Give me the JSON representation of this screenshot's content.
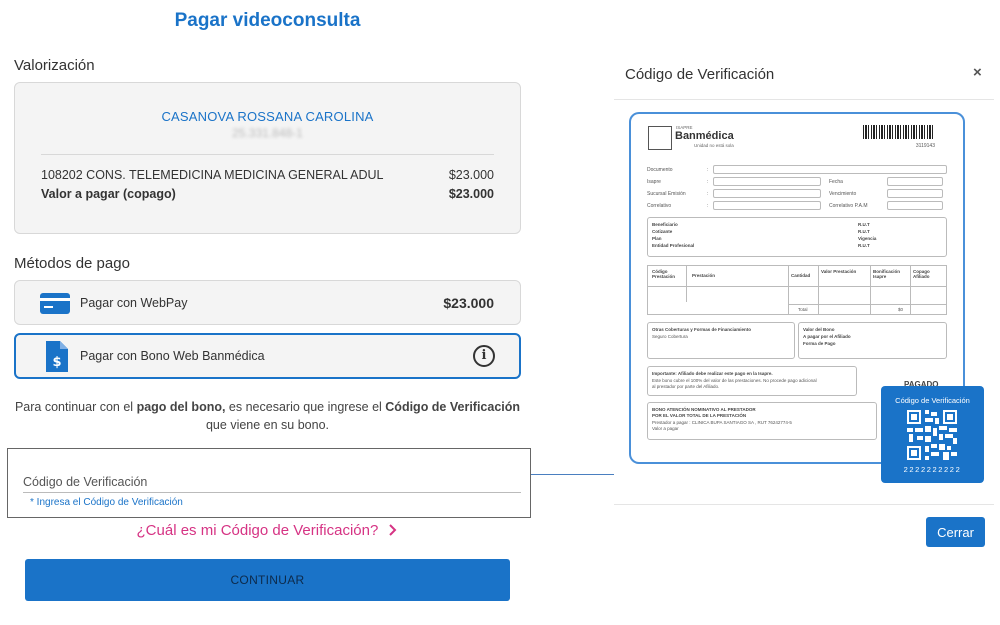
{
  "page": {
    "title": "Pagar videoconsulta"
  },
  "valorizacion": {
    "heading": "Valorización",
    "doctor_name": "CASANOVA ROSSANA CAROLINA",
    "doctor_rut": "25.331.848-1",
    "items": [
      {
        "label": "108202 CONS. TELEMEDICINA MEDICINA GENERAL ADUL",
        "amount": "$23.000"
      }
    ],
    "total_label": "Valor a pagar (copago)",
    "total_amount": "$23.000"
  },
  "metodos": {
    "heading": "Métodos de pago",
    "webpay": {
      "label": "Pagar con WebPay",
      "amount": "$23.000",
      "icon": "credit-card-icon"
    },
    "bono": {
      "label": "Pagar con Bono Web Banmédica",
      "icon": "document-dollar-icon",
      "info_icon": "info-icon",
      "selected": true
    }
  },
  "instructions": {
    "part1": "Para continuar con el ",
    "bold1": "pago del bono,",
    "part2": " es necesario que ingrese el ",
    "bold2": "Código de Verificación",
    "part3": " que viene en su bono."
  },
  "code_field": {
    "placeholder": "Código de Verificación",
    "value": "",
    "hint": "* Ingresa el Código de Verificación"
  },
  "help_link": "¿Cuál es mi Código de Verificación?",
  "continue_label": "CONTINUAR",
  "modal": {
    "title": "Código de Verificación",
    "close_icon": "close-icon",
    "close_label": "Cerrar",
    "document": {
      "isapre_label": "ISAPRE",
      "brand": "Banmédica",
      "slogan": "Unidad no está sola",
      "barcode_number": "3119143",
      "fields_top": [
        "Documento",
        "Isapre",
        "Sucursal Emisión",
        "Correlativo"
      ],
      "fields_right": [
        "Fecha",
        "Vencimiento",
        "Correlativo P.A.M"
      ],
      "beneficiary_fields": [
        "Beneficiario",
        "Cotizante",
        "Plan",
        "Entidad Profesional"
      ],
      "rut_labels": [
        "R.U.T",
        "R.U.T",
        "Vigencia",
        "R.U.T"
      ],
      "table_headers": [
        "Código Prestación",
        "Prestación",
        "Cantidad",
        "Valor Prestación",
        "Bonificación Isapre",
        "Copago Afiliado"
      ],
      "total_label": "Total",
      "total_value": "$0",
      "other_coverage_title": "Otras Coberturas y Formas de Financiamiento",
      "other_coverage_value": "Seguro Cobertura",
      "bono_value_title": "Valor del Bono",
      "bono_value_fields": [
        "A pagar por el Afiliado",
        "Forma de Pago"
      ],
      "important_title": "Importante: Afiliado debe realizar este pago en la Isapre.",
      "important_text_1": "Este bono cubre el 100% del valor de las prestaciones. No procede pago adicional",
      "important_text_2": "al prestador por parte del Afiliado.",
      "paid_stamp": "PAGADO",
      "nominative_title_1": "BONO ATENCIÓN NOMINATIVO AL PRESTADOR",
      "nominative_title_2": "POR EL VALOR TOTAL DE LA PRESTACIÓN",
      "provider_line": "Prestador a pagar : CLINICA BUPA SANTIAGO SA , RUT 76242774-5",
      "value_line": "Valor a pagar"
    },
    "qr": {
      "title": "Código de Verificación",
      "code": "2222222222",
      "icon": "qr-code-icon"
    }
  },
  "colors": {
    "primary": "#1a73c8",
    "link_pink": "#d63384"
  }
}
